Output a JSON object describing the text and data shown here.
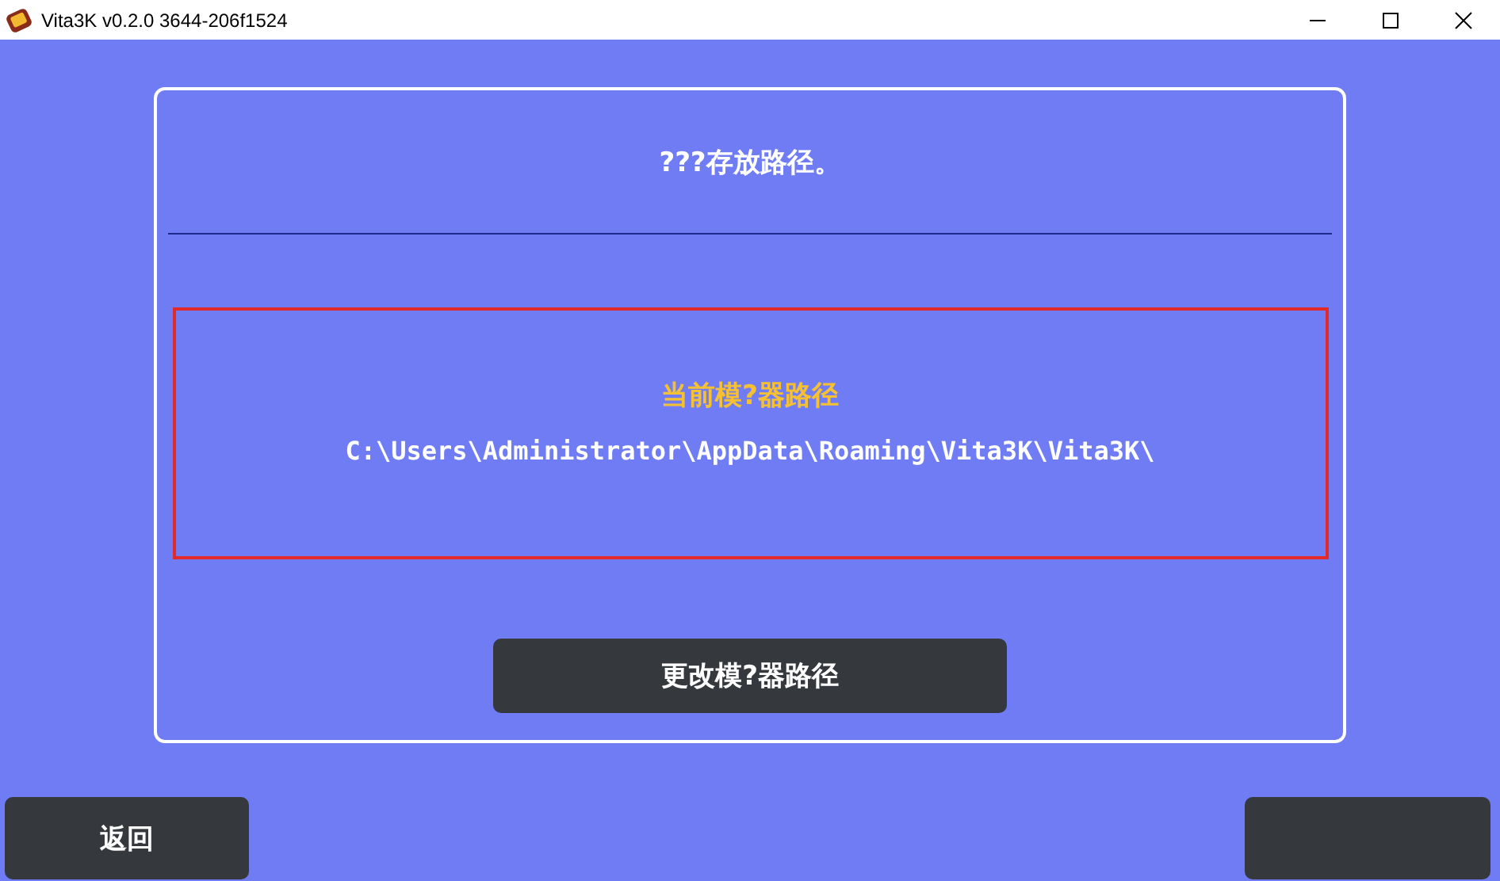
{
  "window": {
    "title": "Vita3K v0.2.0 3644-206f1524"
  },
  "dialog": {
    "heading": "???存放路径。",
    "current_label": "当前模?器路径",
    "current_path": "C:\\Users\\Administrator\\AppData\\Roaming\\Vita3K\\Vita3K\\",
    "change_button": "更改模?器路径"
  },
  "footer": {
    "back_button": "返回"
  }
}
